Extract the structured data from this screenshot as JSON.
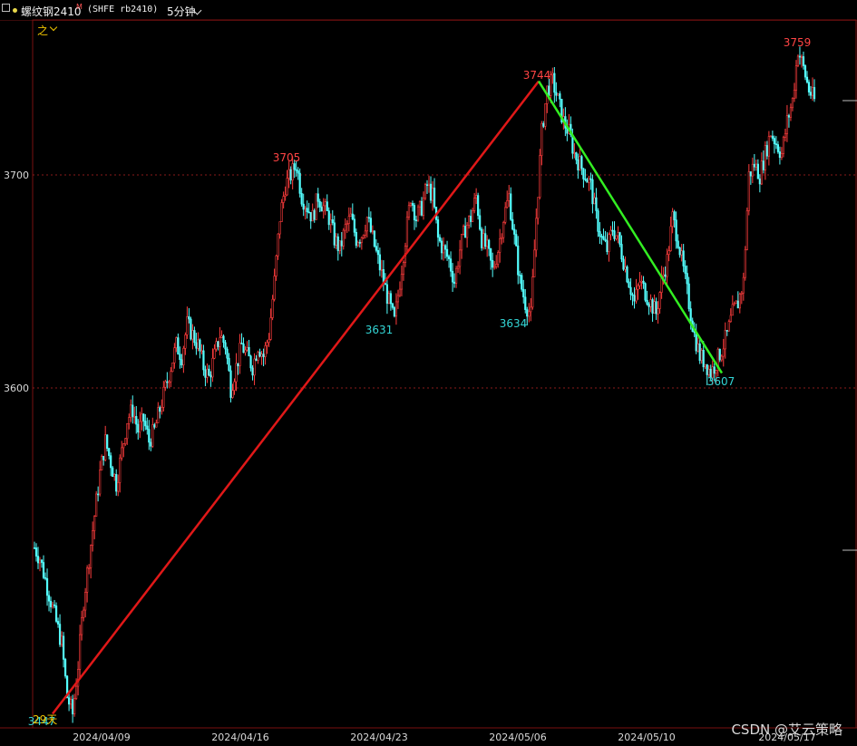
{
  "header": {
    "symbol": "螺纹钢2410",
    "superscript": "M",
    "code": "(SHFE rb2410)",
    "period": "5分钟"
  },
  "toolbar": {
    "drawing_tool": "之"
  },
  "watermark": "CSDN @艾云策略",
  "colors": {
    "background": "#000000",
    "up_candle": "#ff3d3d",
    "down_candle": "#54ffff",
    "up_line": "#e01818",
    "down_line": "#33ee22",
    "high_label": "#ff4444",
    "low_label": "#33d6d6",
    "grid": "#8a1a1a",
    "axis_text": "#d8d8d8"
  },
  "chart_data": {
    "type": "candlestick",
    "y_ticks": [
      3600,
      3700
    ],
    "ylim": [
      3447,
      3759
    ],
    "x_labels": [
      "2024/04/09",
      "2024/04/16",
      "2024/04/23",
      "2024/05/06",
      "2024/05/10",
      "2024/05/17"
    ],
    "pivots": [
      {
        "label": "3447",
        "value": 3447,
        "kind": "low"
      },
      {
        "label": "3705",
        "value": 3705,
        "kind": "high"
      },
      {
        "label": "3631",
        "value": 3631,
        "kind": "low"
      },
      {
        "label": "3634",
        "value": 3634,
        "kind": "low"
      },
      {
        "label": "3744",
        "value": 3744,
        "kind": "high"
      },
      {
        "label": "3607",
        "value": 3607,
        "kind": "low"
      },
      {
        "label": "3759",
        "value": 3759,
        "kind": "high"
      }
    ],
    "wave_lines": [
      {
        "from": 3447,
        "to": 3744,
        "direction": "up"
      },
      {
        "from": 3744,
        "to": 3607,
        "direction": "down"
      }
    ],
    "bottom_left_label": "29天",
    "price_path": [
      3525,
      3520,
      3510,
      3500,
      3490,
      3480,
      3455,
      3447,
      3470,
      3500,
      3520,
      3540,
      3560,
      3575,
      3565,
      3555,
      3570,
      3585,
      3590,
      3580,
      3585,
      3575,
      3580,
      3590,
      3600,
      3610,
      3620,
      3615,
      3630,
      3625,
      3620,
      3610,
      3605,
      3615,
      3625,
      3620,
      3600,
      3610,
      3620,
      3615,
      3610,
      3620,
      3615,
      3625,
      3650,
      3680,
      3695,
      3700,
      3705,
      3690,
      3685,
      3680,
      3690,
      3685,
      3680,
      3670,
      3665,
      3675,
      3680,
      3670,
      3672,
      3680,
      3670,
      3660,
      3650,
      3640,
      3631,
      3650,
      3670,
      3690,
      3680,
      3685,
      3695,
      3690,
      3670,
      3665,
      3660,
      3650,
      3665,
      3675,
      3680,
      3690,
      3670,
      3665,
      3655,
      3665,
      3680,
      3690,
      3670,
      3650,
      3640,
      3634,
      3680,
      3720,
      3740,
      3744,
      3735,
      3725,
      3720,
      3710,
      3705,
      3700,
      3695,
      3680,
      3670,
      3665,
      3675,
      3670,
      3660,
      3650,
      3640,
      3650,
      3645,
      3640,
      3635,
      3650,
      3660,
      3680,
      3670,
      3655,
      3640,
      3625,
      3615,
      3612,
      3607,
      3612,
      3618,
      3625,
      3635,
      3640,
      3650,
      3700,
      3705,
      3700,
      3710,
      3720,
      3715,
      3710,
      3725,
      3735,
      3759,
      3750,
      3740,
      3735
    ]
  }
}
